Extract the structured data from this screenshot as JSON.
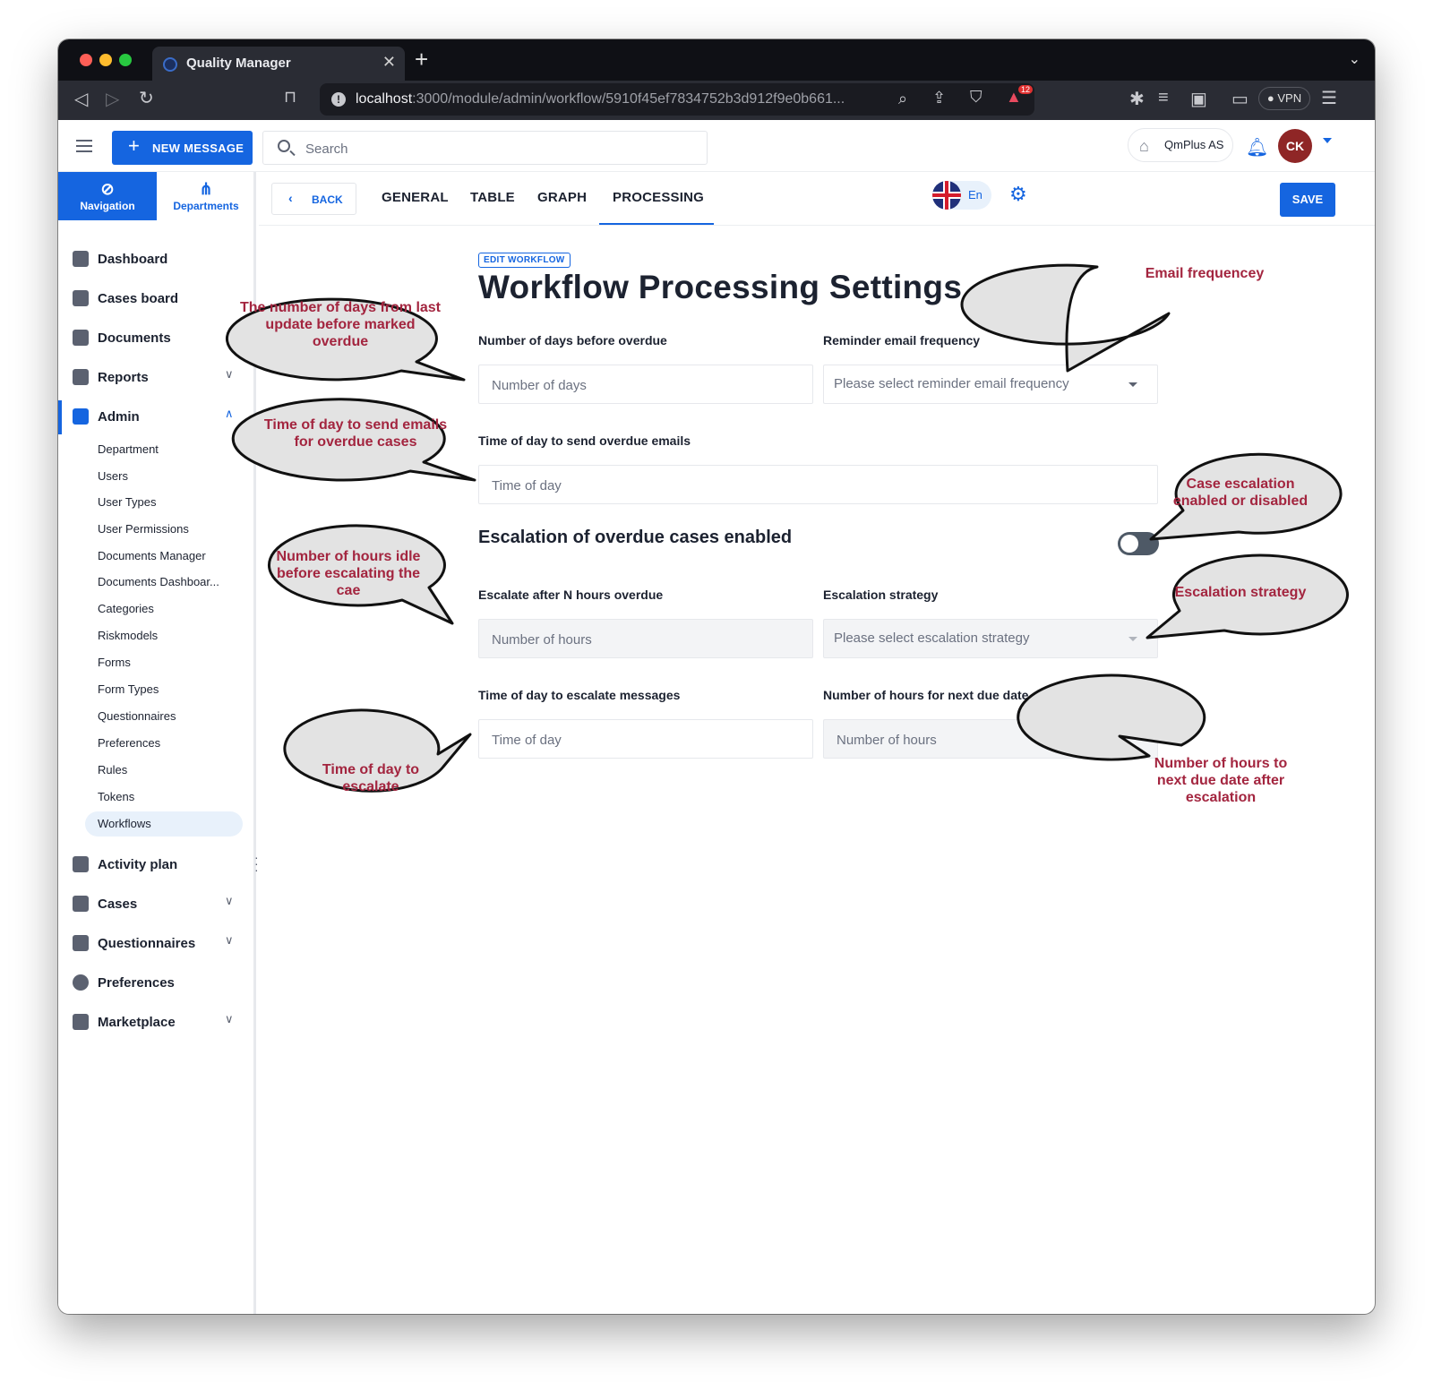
{
  "browser": {
    "tab_title": "Quality Manager",
    "url_host": "localhost",
    "url_rest": ":3000/module/admin/workflow/5910f45ef7834752b3d912f9e0b661...",
    "vpn_label": "VPN",
    "shield_badge_count": "12"
  },
  "header": {
    "new_message_label": "NEW MESSAGE",
    "search_placeholder": "Search",
    "company_name": "QmPlus AS",
    "avatar_initials": "CK"
  },
  "sidebar": {
    "tabs": [
      {
        "label": "Navigation"
      },
      {
        "label": "Departments"
      }
    ],
    "items": [
      {
        "label": "Dashboard"
      },
      {
        "label": "Cases board"
      },
      {
        "label": "Documents"
      },
      {
        "label": "Reports"
      },
      {
        "label": "Admin"
      },
      {
        "label": "Activity plan"
      },
      {
        "label": "Cases"
      },
      {
        "label": "Questionnaires"
      },
      {
        "label": "Preferences"
      },
      {
        "label": "Marketplace"
      }
    ],
    "admin_subitems": [
      "Department",
      "Users",
      "User Types",
      "User Permissions",
      "Documents Manager",
      "Documents Dashboar...",
      "Categories",
      "Riskmodels",
      "Forms",
      "Form Types",
      "Questionnaires",
      "Preferences",
      "Rules",
      "Tokens",
      "Workflows"
    ]
  },
  "content": {
    "back_label": "BACK",
    "tabs": [
      "GENERAL",
      "TABLE",
      "GRAPH",
      "PROCESSING"
    ],
    "active_tab": "PROCESSING",
    "language_code": "En",
    "save_label": "SAVE",
    "badge": "EDIT WORKFLOW",
    "title": "Workflow Processing Settings",
    "fields": {
      "days_overdue": {
        "label": "Number of days before overdue",
        "placeholder": "Number of days"
      },
      "reminder_frequency": {
        "label": "Reminder email frequency",
        "placeholder": "Please select reminder email frequency"
      },
      "overdue_email_time": {
        "label": "Time of day to send overdue emails",
        "placeholder": "Time of day"
      },
      "escalate_hours": {
        "label": "Escalate after N hours overdue",
        "placeholder": "Number of hours"
      },
      "escalation_strategy": {
        "label": "Escalation strategy",
        "placeholder": "Please select escalation strategy"
      },
      "escalate_time": {
        "label": "Time of day to escalate messages",
        "placeholder": "Time of day"
      },
      "next_due_hours": {
        "label": "Number of hours for next due date after escalation",
        "placeholder": "Number of hours"
      }
    },
    "escalation_heading": "Escalation of overdue cases enabled",
    "escalation_enabled": false
  },
  "callouts": {
    "days_overdue": "The number of days from last update before marked overdue",
    "email_time": "Time of day to send emails for overdue cases",
    "idle_hours": "Number of hours idle before escalating the cae",
    "escalate_time": "Time of day to escalate",
    "email_frequency": "Email frequencey",
    "escalation_toggle": "Case escalation enabled or disabled",
    "escalation_strategy": "Escalation strategy",
    "next_due": "Number of hours to next due date after escalation"
  },
  "colors": {
    "accent": "#1565e0",
    "callout_text": "#a3253f",
    "callout_fill": "#e3e3e3"
  }
}
